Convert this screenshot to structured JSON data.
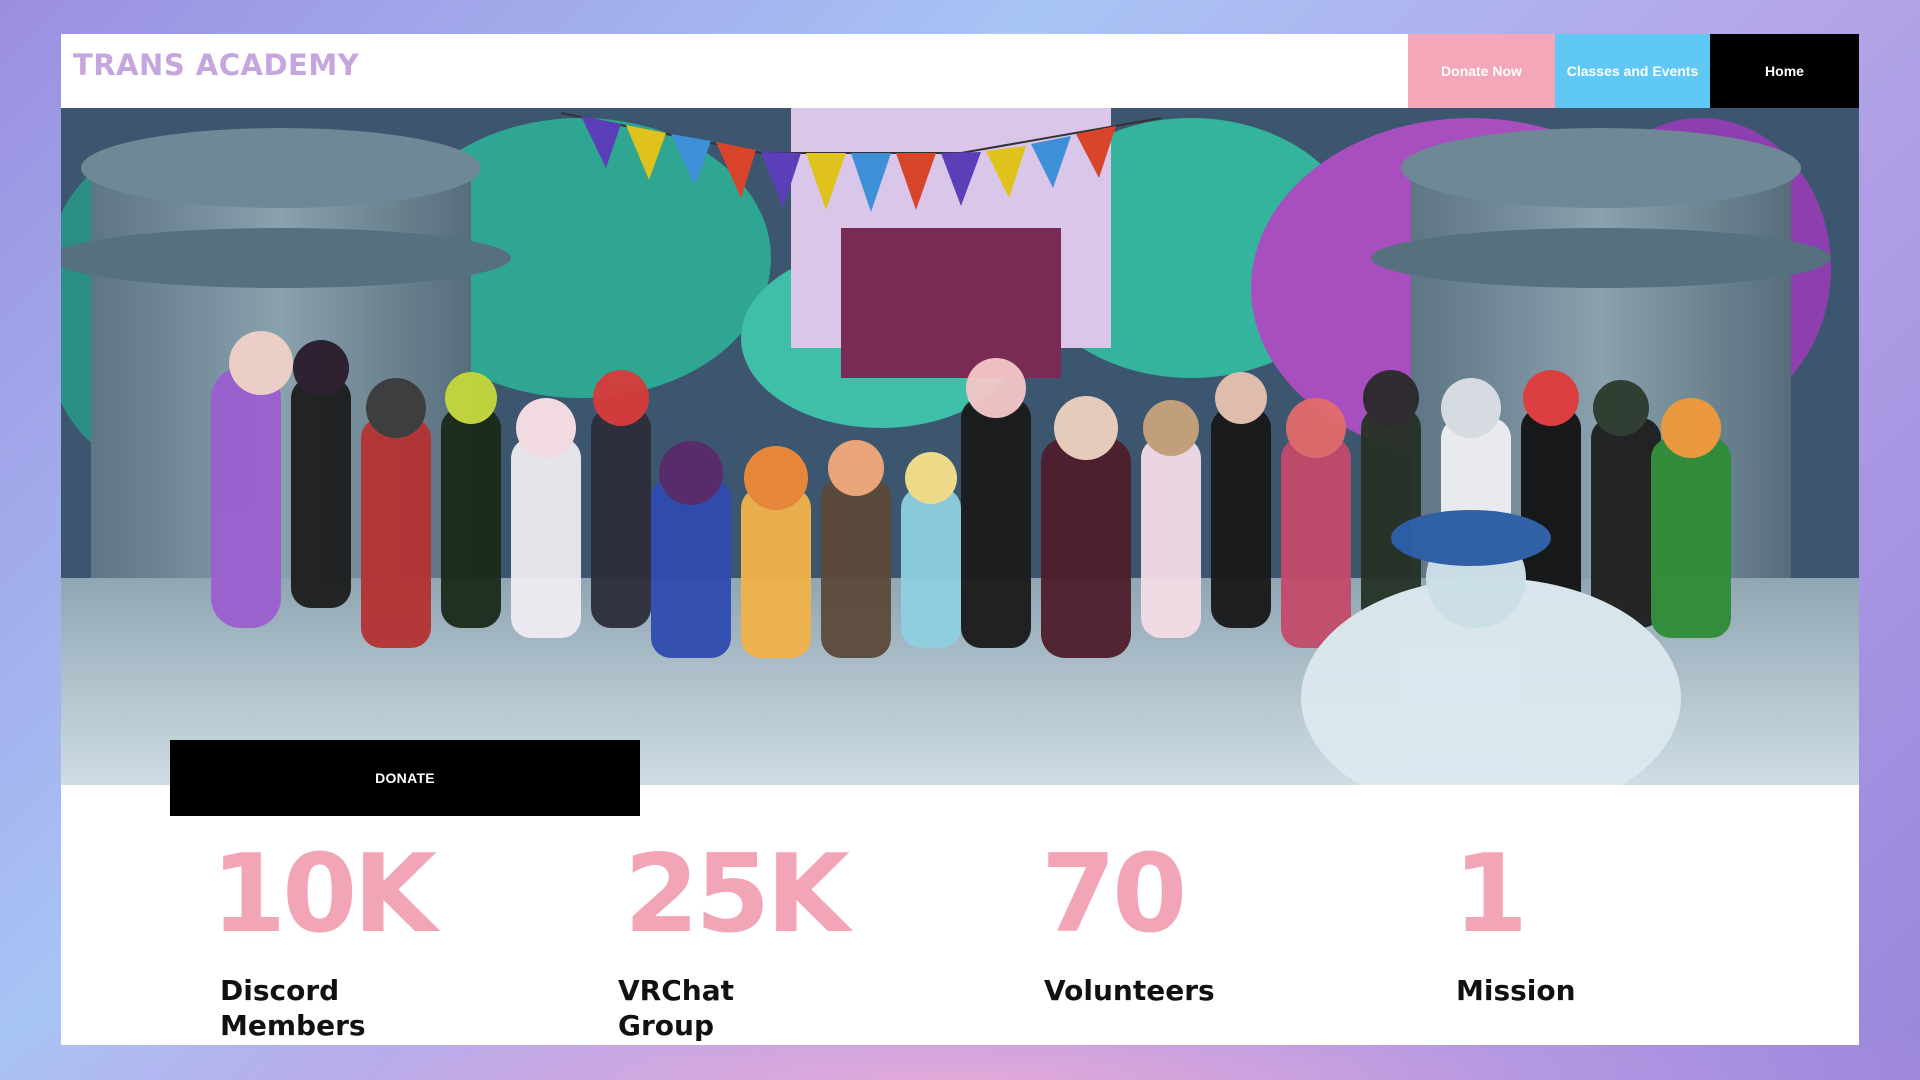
{
  "brand": {
    "name": "TRANS ACADEMY",
    "color": "#c5a6de"
  },
  "nav": {
    "items": [
      {
        "label": "Donate Now",
        "color": "#f4a7b9"
      },
      {
        "label": "Classes and Events",
        "color": "#5fc8f5"
      },
      {
        "label": "Home",
        "color": "#000000"
      }
    ]
  },
  "hero": {
    "image": "group-photo-of-vrchat-avatars",
    "donate_label": "DONATE"
  },
  "stats": [
    {
      "value": "10K",
      "label": "Discord\nMembers"
    },
    {
      "value": "25K",
      "label": "VRChat Group\nMembers"
    },
    {
      "value": "70",
      "label": "Volunteers"
    },
    {
      "value": "1",
      "label": "Mission"
    }
  ],
  "colors": {
    "accent_pink": "#f3a5b8",
    "accent_blue": "#5fc8f5"
  }
}
